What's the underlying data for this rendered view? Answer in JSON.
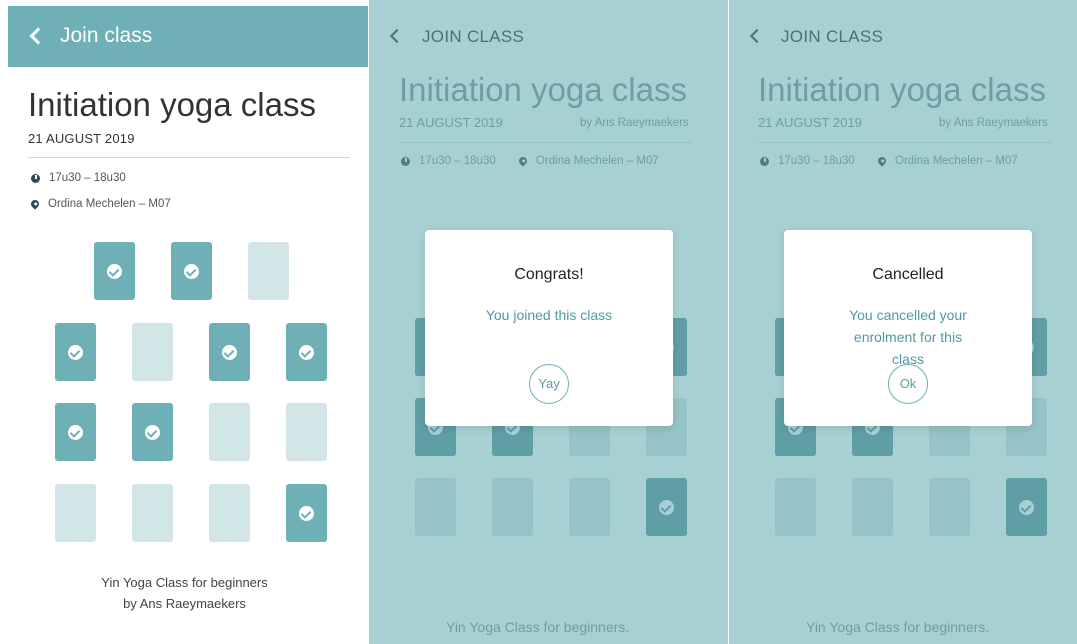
{
  "screen1": {
    "header_title": "Join class",
    "class_title": "Initiation yoga class",
    "date": "21 AUGUST 2019",
    "time": "17u30 – 18u30",
    "location": "Ordina Mechelen – M07",
    "footer_line1": "Yin Yoga Class for beginners",
    "footer_by": "by",
    "footer_name": "Ans Raeymaekers"
  },
  "screen2": {
    "header_title": "JOIN CLASS",
    "class_title": "Initiation yoga class",
    "date": "21 AUGUST 2019",
    "by": "by Ans Raeymaekers",
    "time": "17u30 – 18u30",
    "location": "Ordina Mechelen – M07",
    "modal": {
      "title": "Congrats!",
      "message": "You joined this class",
      "button": "Yay"
    },
    "footer": "Yin Yoga Class for beginners."
  },
  "screen3": {
    "header_title": "JOIN CLASS",
    "class_title": "Initiation yoga class",
    "date": "21 AUGUST 2019",
    "by": "by Ans Raeymaekers",
    "time": "17u30 – 18u30",
    "location": "Ordina Mechelen – M07",
    "modal": {
      "title": "Cancelled",
      "message": "You cancelled your enrolment for this class",
      "button": "Ok"
    },
    "footer": "Yin Yoga Class for beginners."
  },
  "seat_rows": [
    [
      "taken",
      "taken",
      "free"
    ],
    [
      "taken",
      "free",
      "taken",
      "taken"
    ],
    [
      "taken",
      "taken",
      "free",
      "free"
    ],
    [
      "free",
      "free",
      "free",
      "taken"
    ]
  ],
  "colors": {
    "accent": "#6fb0b7",
    "seat_free": "#d2e6e8",
    "overlay": "#a7d0d3"
  }
}
